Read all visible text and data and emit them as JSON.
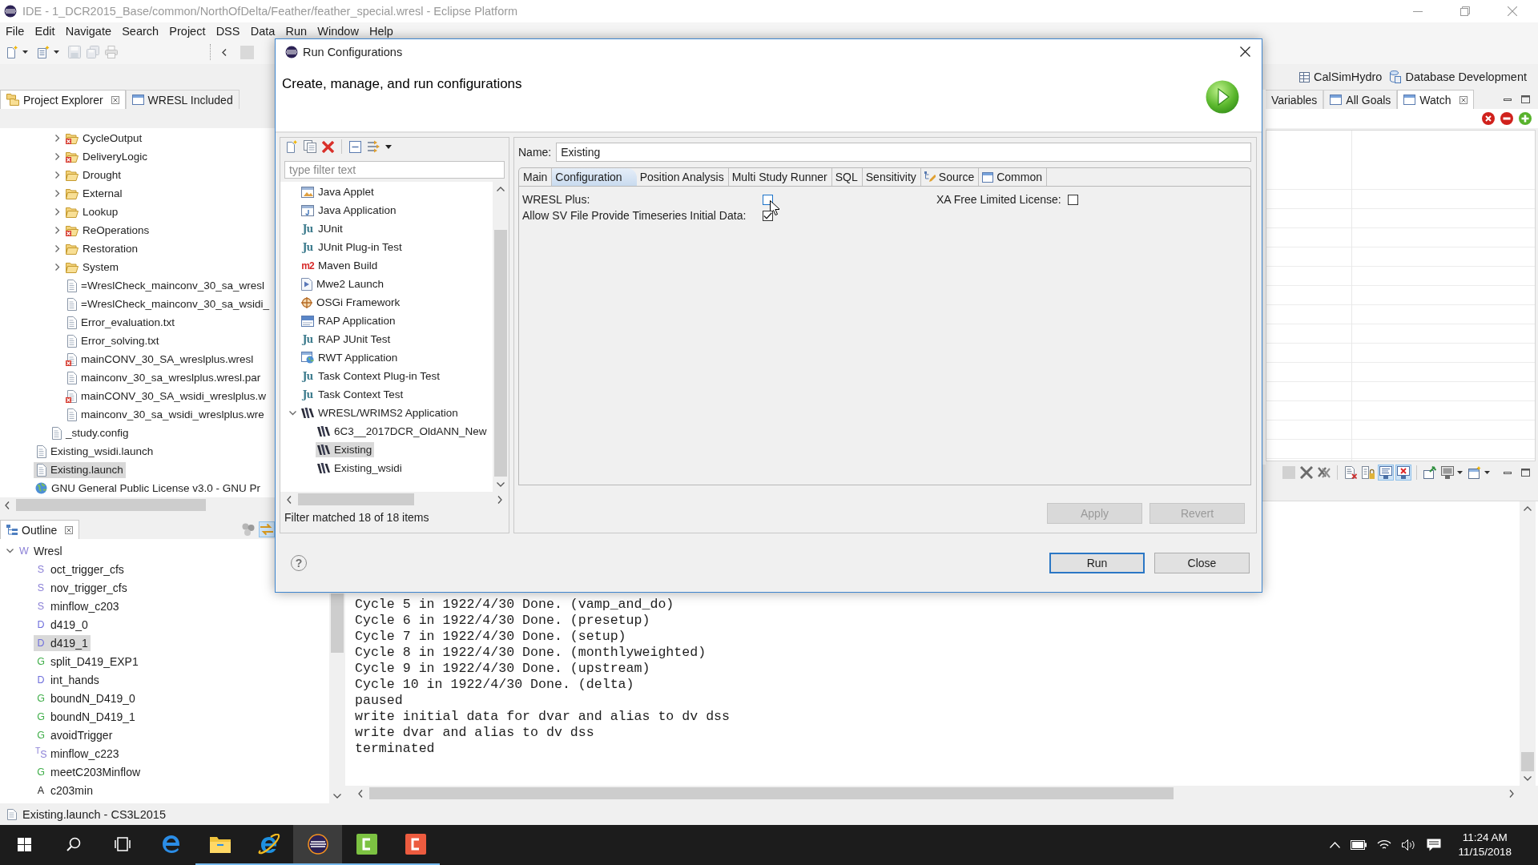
{
  "window": {
    "title": "IDE - 1_DCR2015_Base/common/NorthOfDelta/Feather/feather_special.wresl - Eclipse Platform"
  },
  "menu": [
    "File",
    "Edit",
    "Navigate",
    "Search",
    "Project",
    "DSS",
    "Data",
    "Run",
    "Window",
    "Help"
  ],
  "toolbar": [
    {
      "kind": "new",
      "disabled": false,
      "dropdown": true
    },
    {
      "kind": "newitem",
      "disabled": false,
      "dropdown": true
    },
    {
      "kind": "save",
      "disabled": true,
      "dropdown": false
    },
    {
      "kind": "saveall",
      "disabled": true,
      "dropdown": false
    },
    {
      "kind": "print",
      "disabled": true,
      "dropdown": false
    }
  ],
  "perspectives": [
    {
      "label": "CalSimHydro",
      "kind": "table"
    },
    {
      "label": "Database Development",
      "kind": "database"
    }
  ],
  "project_explorer": {
    "tabs": [
      {
        "label": "Project Explorer",
        "kind": "explorer",
        "selected": true
      },
      {
        "label": "WRESL Included",
        "kind": "view",
        "selected": false
      }
    ],
    "tree": [
      {
        "children": [
          {
            "children": [
              {
                "label": "CycleOutput",
                "kind": "folder",
                "expanded": false,
                "error": true,
                "selected": false
              },
              {
                "label": "DeliveryLogic",
                "kind": "folder",
                "expanded": false,
                "error": true,
                "selected": false
              },
              {
                "label": "Drought",
                "kind": "folder",
                "expanded": false,
                "error": false,
                "selected": false
              },
              {
                "label": "External",
                "kind": "folder",
                "expanded": false,
                "error": false,
                "selected": false
              },
              {
                "label": "Lookup",
                "kind": "folder",
                "expanded": false,
                "error": false,
                "selected": false
              },
              {
                "label": "ReOperations",
                "kind": "folder",
                "expanded": false,
                "error": true,
                "selected": false
              },
              {
                "label": "Restoration",
                "kind": "folder",
                "expanded": false,
                "error": false,
                "selected": false
              },
              {
                "label": "System",
                "kind": "folder",
                "expanded": false,
                "error": false,
                "selected": false
              },
              {
                "label": "=WreslCheck_mainconv_30_sa_wresl",
                "kind": "file",
                "error": false,
                "selected": false
              },
              {
                "label": "=WreslCheck_mainconv_30_sa_wsidi_",
                "kind": "file",
                "error": false,
                "selected": false
              },
              {
                "label": "Error_evaluation.txt",
                "kind": "file",
                "error": false,
                "selected": false
              },
              {
                "label": "Error_solving.txt",
                "kind": "file",
                "error": false,
                "selected": false
              },
              {
                "label": "mainCONV_30_SA_wreslplus.wresl",
                "kind": "file",
                "error": true,
                "selected": false
              },
              {
                "label": "mainconv_30_sa_wreslplus.wresl.par",
                "kind": "file",
                "error": false,
                "selected": false
              },
              {
                "label": "mainCONV_30_SA_wsidi_wreslplus.w",
                "kind": "file",
                "error": true,
                "selected": false
              },
              {
                "label": "mainconv_30_sa_wsidi_wreslplus.wre",
                "kind": "file",
                "error": false,
                "selected": false
              }
            ]
          },
          {
            "label": "_study.config",
            "kind": "file",
            "error": false,
            "selected": false
          }
        ]
      },
      {
        "label": "Existing_wsidi.launch",
        "kind": "file",
        "error": false,
        "selected": false
      },
      {
        "label": "Existing.launch",
        "kind": "file",
        "error": false,
        "selected": true
      },
      {
        "label": "GNU General Public License v3.0 - GNU Pr",
        "kind": "web",
        "error": false,
        "selected": false
      }
    ]
  },
  "watch_panel": {
    "tabs": [
      {
        "label": "Variables",
        "kind": "text",
        "selected": false
      },
      {
        "label": "All Goals",
        "kind": "view",
        "selected": false
      },
      {
        "label": "Watch",
        "kind": "view",
        "selected": true
      }
    ]
  },
  "outline": {
    "tabs": [
      {
        "label": "Outline",
        "kind": "outline",
        "selected": true
      }
    ],
    "toolbar": [
      {
        "kind": "dots",
        "on": false
      },
      {
        "kind": "sync",
        "on": true
      }
    ],
    "tree": [
      {
        "label": "Wresl",
        "letter": "W",
        "color": "#8a7fd6",
        "expanded": true,
        "selected": false,
        "children": [
          {
            "label": "oct_trigger_cfs",
            "letter": "S",
            "color": "#8a7fd6",
            "selected": false
          },
          {
            "label": "nov_trigger_cfs",
            "letter": "S",
            "color": "#8a7fd6",
            "selected": false
          },
          {
            "label": "minflow_c203",
            "letter": "S",
            "color": "#8a7fd6",
            "selected": false
          },
          {
            "label": "d419_0",
            "letter": "D",
            "color": "#7070dc",
            "selected": false
          },
          {
            "label": "d419_1",
            "letter": "D",
            "color": "#7070dc",
            "selected": true
          },
          {
            "label": "split_D419_EXP1",
            "letter": "G",
            "color": "#3fae49",
            "selected": false
          },
          {
            "label": "int_hands",
            "letter": "D",
            "color": "#7070dc",
            "selected": false
          },
          {
            "label": "boundN_D419_0",
            "letter": "G",
            "color": "#3fae49",
            "selected": false
          },
          {
            "label": "boundN_D419_1",
            "letter": "G",
            "color": "#3fae49",
            "selected": false
          },
          {
            "label": "avoidTrigger",
            "letter": "G",
            "color": "#3fae49",
            "selected": false
          },
          {
            "label": "minflow_c223",
            "letter": "$^{T}$S",
            "color": "#8a7fd6",
            "selected": false
          },
          {
            "label": "meetC203Minflow",
            "letter": "G",
            "color": "#3fae49",
            "selected": false
          },
          {
            "label": "c203min",
            "letter": "A",
            "color": "#1e1e1e",
            "selected": false
          }
        ]
      }
    ]
  },
  "console": {
    "toolbar": [
      [
        {
          "kind": "stop",
          "disabled": true,
          "on": false
        },
        {
          "kind": "remove",
          "disabled": false,
          "on": false
        },
        {
          "kind": "removeall",
          "disabled": false,
          "on": false
        }
      ],
      [
        {
          "kind": "clear",
          "disabled": false,
          "on": false
        },
        {
          "kind": "lock",
          "disabled": false,
          "on": false
        },
        {
          "kind": "stdout",
          "disabled": false,
          "on": true
        },
        {
          "kind": "stderr",
          "disabled": false,
          "on": true
        }
      ],
      [
        {
          "kind": "pin",
          "disabled": false,
          "on": false
        },
        {
          "kind": "monitor",
          "disabled": false,
          "on": false,
          "dropdown": true
        },
        {
          "kind": "newconsole",
          "disabled": false,
          "on": false,
          "dropdown": true
        }
      ]
    ],
    "lines": [
      "Cycle 5 in 1922/4/30 Done. (vamp_and_do)",
      "Cycle 6 in 1922/4/30 Done. (presetup)",
      "Cycle 7 in 1922/4/30 Done. (setup)",
      "Cycle 8 in 1922/4/30 Done. (monthlyweighted)",
      "Cycle 9 in 1922/4/30 Done. (upstream)",
      "Cycle 10 in 1922/4/30 Done. (delta)",
      "paused",
      "write initial data for dvar and alias to dv dss",
      "write dvar and alias to dv dss",
      "terminated"
    ]
  },
  "status_bar": "Existing.launch - CS3L2015",
  "dialog": {
    "title": "Run Configurations",
    "heading": "Create, manage, and run configurations",
    "filter": {
      "placeholder": "type filter text"
    },
    "tree": [
      {
        "label": "Java Applet",
        "kind": "applet",
        "selected": false
      },
      {
        "label": "Java Application",
        "kind": "app",
        "selected": false
      },
      {
        "label": "JUnit",
        "kind": "junit",
        "glyph": "Ju",
        "selected": false
      },
      {
        "label": "JUnit Plug-in Test",
        "kind": "junit",
        "glyph": "Ju",
        "selected": false
      },
      {
        "label": "Maven Build",
        "kind": "maven",
        "glyph": "m2",
        "selected": false
      },
      {
        "label": "Mwe2 Launch",
        "kind": "doc",
        "selected": false
      },
      {
        "label": "OSGi Framework",
        "kind": "osgi",
        "selected": false
      },
      {
        "label": "RAP Application",
        "kind": "rap",
        "selected": false
      },
      {
        "label": "RAP JUnit Test",
        "kind": "junit",
        "glyph": "Ju",
        "selected": false
      },
      {
        "label": "RWT Application",
        "kind": "rwt",
        "selected": false
      },
      {
        "label": "Task Context Plug-in Test",
        "kind": "junit",
        "glyph": "Ju",
        "selected": false
      },
      {
        "label": "Task Context Test",
        "kind": "junit",
        "glyph": "Ju",
        "selected": false
      },
      {
        "label": "WRESL/WRIMS2 Application",
        "kind": "wresl",
        "expanded": true,
        "selected": false,
        "children": [
          {
            "label": "6C3__2017DCR_OldANN_New",
            "kind": "wresl",
            "selected": false
          },
          {
            "label": "Existing",
            "kind": "wresl",
            "selected": true
          },
          {
            "label": "Existing_wsidi",
            "kind": "wresl",
            "selected": false
          }
        ]
      }
    ],
    "filter_status": "Filter matched 18 of 18 items",
    "name": {
      "label": "Name:",
      "value": "Existing"
    },
    "tabs": [
      {
        "label": "Main",
        "kind": "plain",
        "selected": false
      },
      {
        "label": "Configuration",
        "kind": "plain",
        "selected": true
      },
      {
        "label": "Position Analysis",
        "kind": "plain",
        "selected": false
      },
      {
        "label": "Multi Study Runner",
        "kind": "plain",
        "selected": false
      },
      {
        "label": "SQL",
        "kind": "plain",
        "selected": false
      },
      {
        "label": "Sensitivity",
        "kind": "plain",
        "selected": false
      },
      {
        "label": "Source",
        "kind": "source",
        "selected": false
      },
      {
        "label": "Common",
        "kind": "common",
        "selected": false
      }
    ],
    "option_columns": [
      [
        {
          "label": "WRESL Plus:",
          "checked": false,
          "hovered": true
        },
        {
          "label": "Allow SV File Provide Timeseries Initial Data:",
          "checked": true,
          "hovered": false
        }
      ],
      [
        {
          "label": "XA Free Limited License:",
          "checked": false,
          "hovered": false
        }
      ]
    ],
    "pane_buttons": [
      {
        "label": "Apply",
        "disabled": true
      },
      {
        "label": "Revert",
        "disabled": true
      }
    ],
    "help": "?",
    "buttons": [
      {
        "label": "Run",
        "default": true
      },
      {
        "label": "Close",
        "default": false
      }
    ]
  },
  "taskbar": {
    "apps": [
      {
        "kind": "start",
        "running": false,
        "active": false
      },
      {
        "kind": "search",
        "running": false,
        "active": false
      },
      {
        "kind": "taskview",
        "running": false,
        "active": false
      },
      {
        "kind": "ebrowser",
        "running": false,
        "active": false
      },
      {
        "kind": "folder",
        "running": true,
        "active": false
      },
      {
        "kind": "eorbit",
        "running": true,
        "active": false
      },
      {
        "kind": "stripes",
        "running": true,
        "active": true
      },
      {
        "kind": "tile",
        "color": "#7cc242",
        "running": true,
        "active": false
      },
      {
        "kind": "tile",
        "color": "#ec5b3f",
        "running": true,
        "active": false
      }
    ],
    "time": "11:24 AM",
    "date": "11/15/2018"
  }
}
